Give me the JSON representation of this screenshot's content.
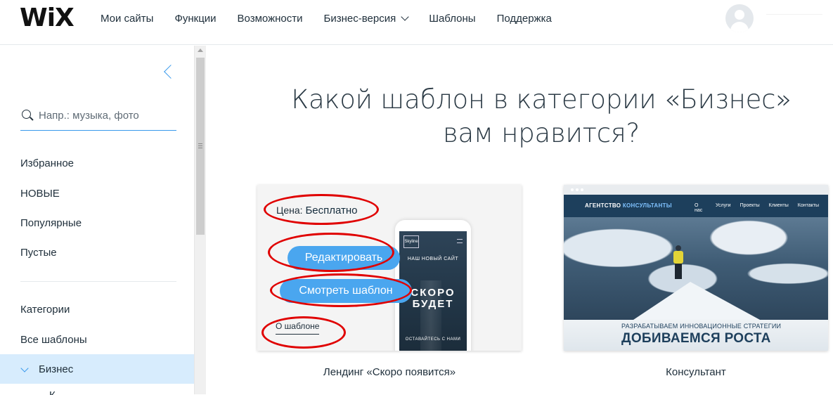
{
  "header": {
    "logo": "WiX",
    "nav": [
      "Мои сайты",
      "Функции",
      "Возможности",
      "Бизнес-версия",
      "Шаблоны",
      "Поддержка"
    ]
  },
  "sidebar": {
    "search_placeholder": "Напр.: музыка, фото",
    "items": [
      "Избранное",
      "НОВЫЕ",
      "Популярные",
      "Пустые"
    ],
    "categories_label": "Категории",
    "all_templates": "Все шаблоны",
    "active_category": "Бизнес",
    "sub_peek": "К"
  },
  "main": {
    "title_line1": "Какой шаблон в категории «Бизнес»",
    "title_line2": "вам нравится?"
  },
  "cards": [
    {
      "price_label": "Цена:",
      "price_value": "Бесплатно",
      "edit_button": "Редактировать",
      "view_button": "Смотреть шаблон",
      "about_link": "О шаблоне",
      "phone_logo": "Skyline",
      "phone_sub": "НАШ НОВЫЙ САЙТ",
      "phone_big": "СКОРО БУДЕТ",
      "phone_foot": "ОСТАВАЙТЕСЬ С НАМИ",
      "caption": "Лендинг «Скоро появится»"
    },
    {
      "brand": "АГЕНТСТВО",
      "brand_accent": "КОНСУЛЬТАНТЫ",
      "links": [
        "О нас",
        "Услуги",
        "Проекты",
        "Клиенты",
        "Контакты"
      ],
      "tagline_small": "РАЗРАБАТЫВАЕМ ИННОВАЦИОННЫЕ СТРАТЕГИИ",
      "tagline_big": "ДОБИВАЕМСЯ РОСТА",
      "caption": "Консультант"
    }
  ],
  "colors": {
    "accent": "#3899ec",
    "button": "#4aa6ef",
    "annotation": "#e00000",
    "selected_bg": "#d7ecfd",
    "consult_nav": "#1d3f5c"
  }
}
